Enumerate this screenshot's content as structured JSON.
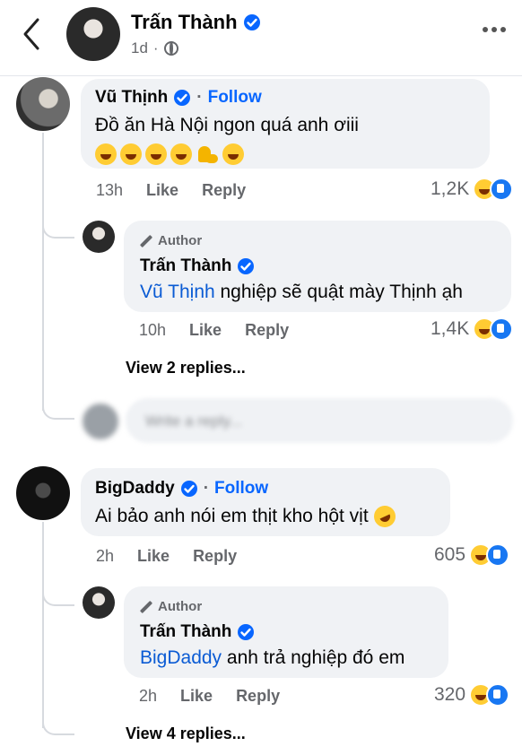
{
  "header": {
    "name": "Trấn Thành",
    "time": "1d"
  },
  "comments": [
    {
      "name": "Vũ Thịnh",
      "follow": "Follow",
      "text": "Đồ ăn Hà Nội ngon quá anh ơiii",
      "time": "13h",
      "like": "Like",
      "reply": "Reply",
      "reactions": "1,2K",
      "reply_item": {
        "author_tag": "Author",
        "name": "Trấn Thành",
        "mention": "Vũ Thịnh",
        "text": " nghiệp sẽ quật mày Thịnh ạh",
        "time": "10h",
        "like": "Like",
        "reply": "Reply",
        "reactions": "1,4K"
      },
      "view_replies": "View 2 replies..."
    },
    {
      "name": "BigDaddy",
      "follow": "Follow",
      "text": "Ai bảo anh nói em thịt kho hột vịt",
      "time": "2h",
      "like": "Like",
      "reply": "Reply",
      "reactions": "605",
      "reply_item": {
        "author_tag": "Author",
        "name": "Trấn Thành",
        "mention": "BigDaddy",
        "text": " anh trả nghiệp đó em",
        "time": "2h",
        "like": "Like",
        "reply": "Reply",
        "reactions": "320"
      },
      "view_replies": "View 4 replies..."
    }
  ],
  "reply_box": {
    "placeholder": "Write a reply..."
  },
  "colors": {
    "link": "#0866ff",
    "mention": "#0a5bd4",
    "bubble": "#f0f2f5",
    "meta": "#65676b",
    "verified": "#0866ff"
  }
}
